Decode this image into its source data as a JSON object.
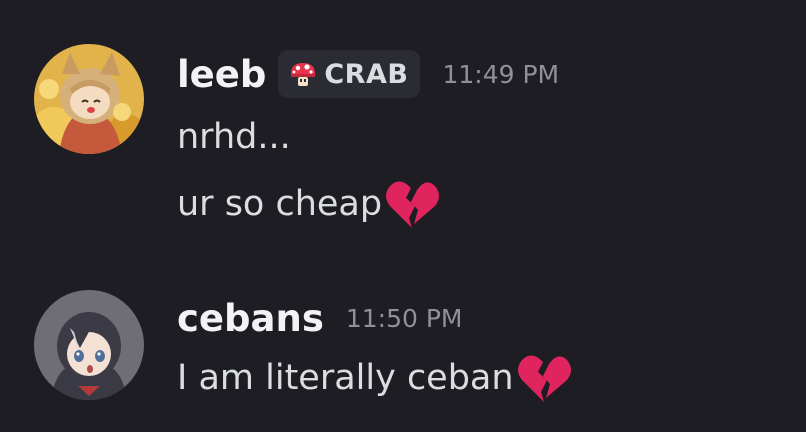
{
  "messages": [
    {
      "username": "leeb",
      "tag": {
        "icon": "mushroom-icon",
        "label": "CRAB"
      },
      "timestamp": "11:49 PM",
      "lines": [
        "nrhd...",
        "ur so cheap"
      ]
    },
    {
      "username": "cebans",
      "timestamp": "11:50 PM",
      "lines": [
        "I am literally ceban "
      ]
    }
  ],
  "icons": {
    "reaction_emoji": "broken-heart-icon"
  },
  "colors": {
    "background": "#1d1d23",
    "username": "#f2f3f5",
    "text": "#dbdee1",
    "timestamp": "#8e9297",
    "tag_bg": "#2b2c33",
    "broken_heart": "#e0245e"
  }
}
